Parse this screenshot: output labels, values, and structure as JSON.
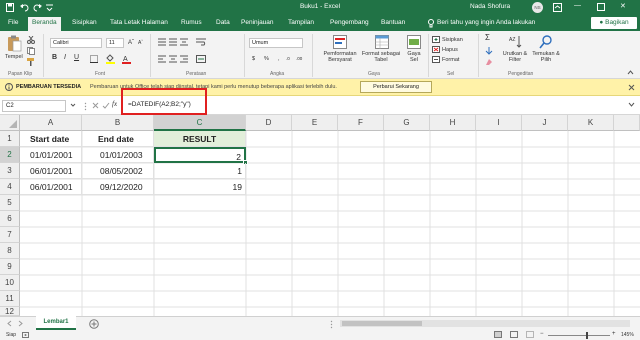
{
  "window": {
    "title": "Buku1 - Excel",
    "user": "Nada Shofura",
    "avatar_initials": "NS"
  },
  "tabs": [
    "File",
    "Beranda",
    "Sisipkan",
    "Tata Letak Halaman",
    "Rumus",
    "Data",
    "Peninjauan",
    "Tampilan",
    "Pengembang",
    "Bantuan"
  ],
  "active_tab": "Beranda",
  "tell_me": "Beri tahu yang ingin Anda lakukan",
  "share_label": "Bagikan",
  "ribbon": {
    "paste": "Tempel",
    "font_name": "Calibri",
    "font_size": "11",
    "number_format": "Umum",
    "cond_format": "Pemformatan Bersyarat",
    "format_table": "Format sebagai Tabel",
    "cell_styles": "Gaya Sel",
    "insert": "Sisipkan",
    "delete": "Hapus",
    "format": "Format",
    "sort_filter": "Urutkan & Filter",
    "find_select": "Temukan & Pilih",
    "groups": [
      "Papan Klip",
      "Font",
      "Perataan",
      "Angka",
      "Gaya",
      "Sel",
      "Pengeditan"
    ]
  },
  "infobar": {
    "title": "PEMBARUAN TERSEDIA",
    "message": "Pembaruan untuk Office telah siap diinstal, tetapi kami perlu menutup beberapa aplikasi terlebih dulu.",
    "button": "Perbarui Sekarang"
  },
  "formula_bar": {
    "name_box": "C2",
    "fx": "fx",
    "formula": "=DATEDIF(A2;B2;\"y\")"
  },
  "columns": [
    "A",
    "B",
    "C",
    "D",
    "E",
    "F",
    "G",
    "H",
    "I",
    "J",
    "K"
  ],
  "rows": [
    "1",
    "2",
    "3",
    "4",
    "5",
    "6",
    "7",
    "8",
    "9",
    "10",
    "11",
    "12"
  ],
  "cells": {
    "A1": "Start date",
    "B1": "End date",
    "C1": "RESULT",
    "A2": "01/01/2001",
    "B2": "01/01/2003",
    "C2": "2",
    "A3": "06/01/2001",
    "B3": "08/05/2002",
    "C3": "1",
    "A4": "06/01/2001",
    "B4": "09/12/2020",
    "C4": "19"
  },
  "sheet_tab": "Lembar1",
  "status": {
    "ready": "Siap",
    "zoom": "145%"
  },
  "colors": {
    "excel_green": "#217346",
    "header_fill": "#e2efda",
    "highlight": "#e02020"
  }
}
